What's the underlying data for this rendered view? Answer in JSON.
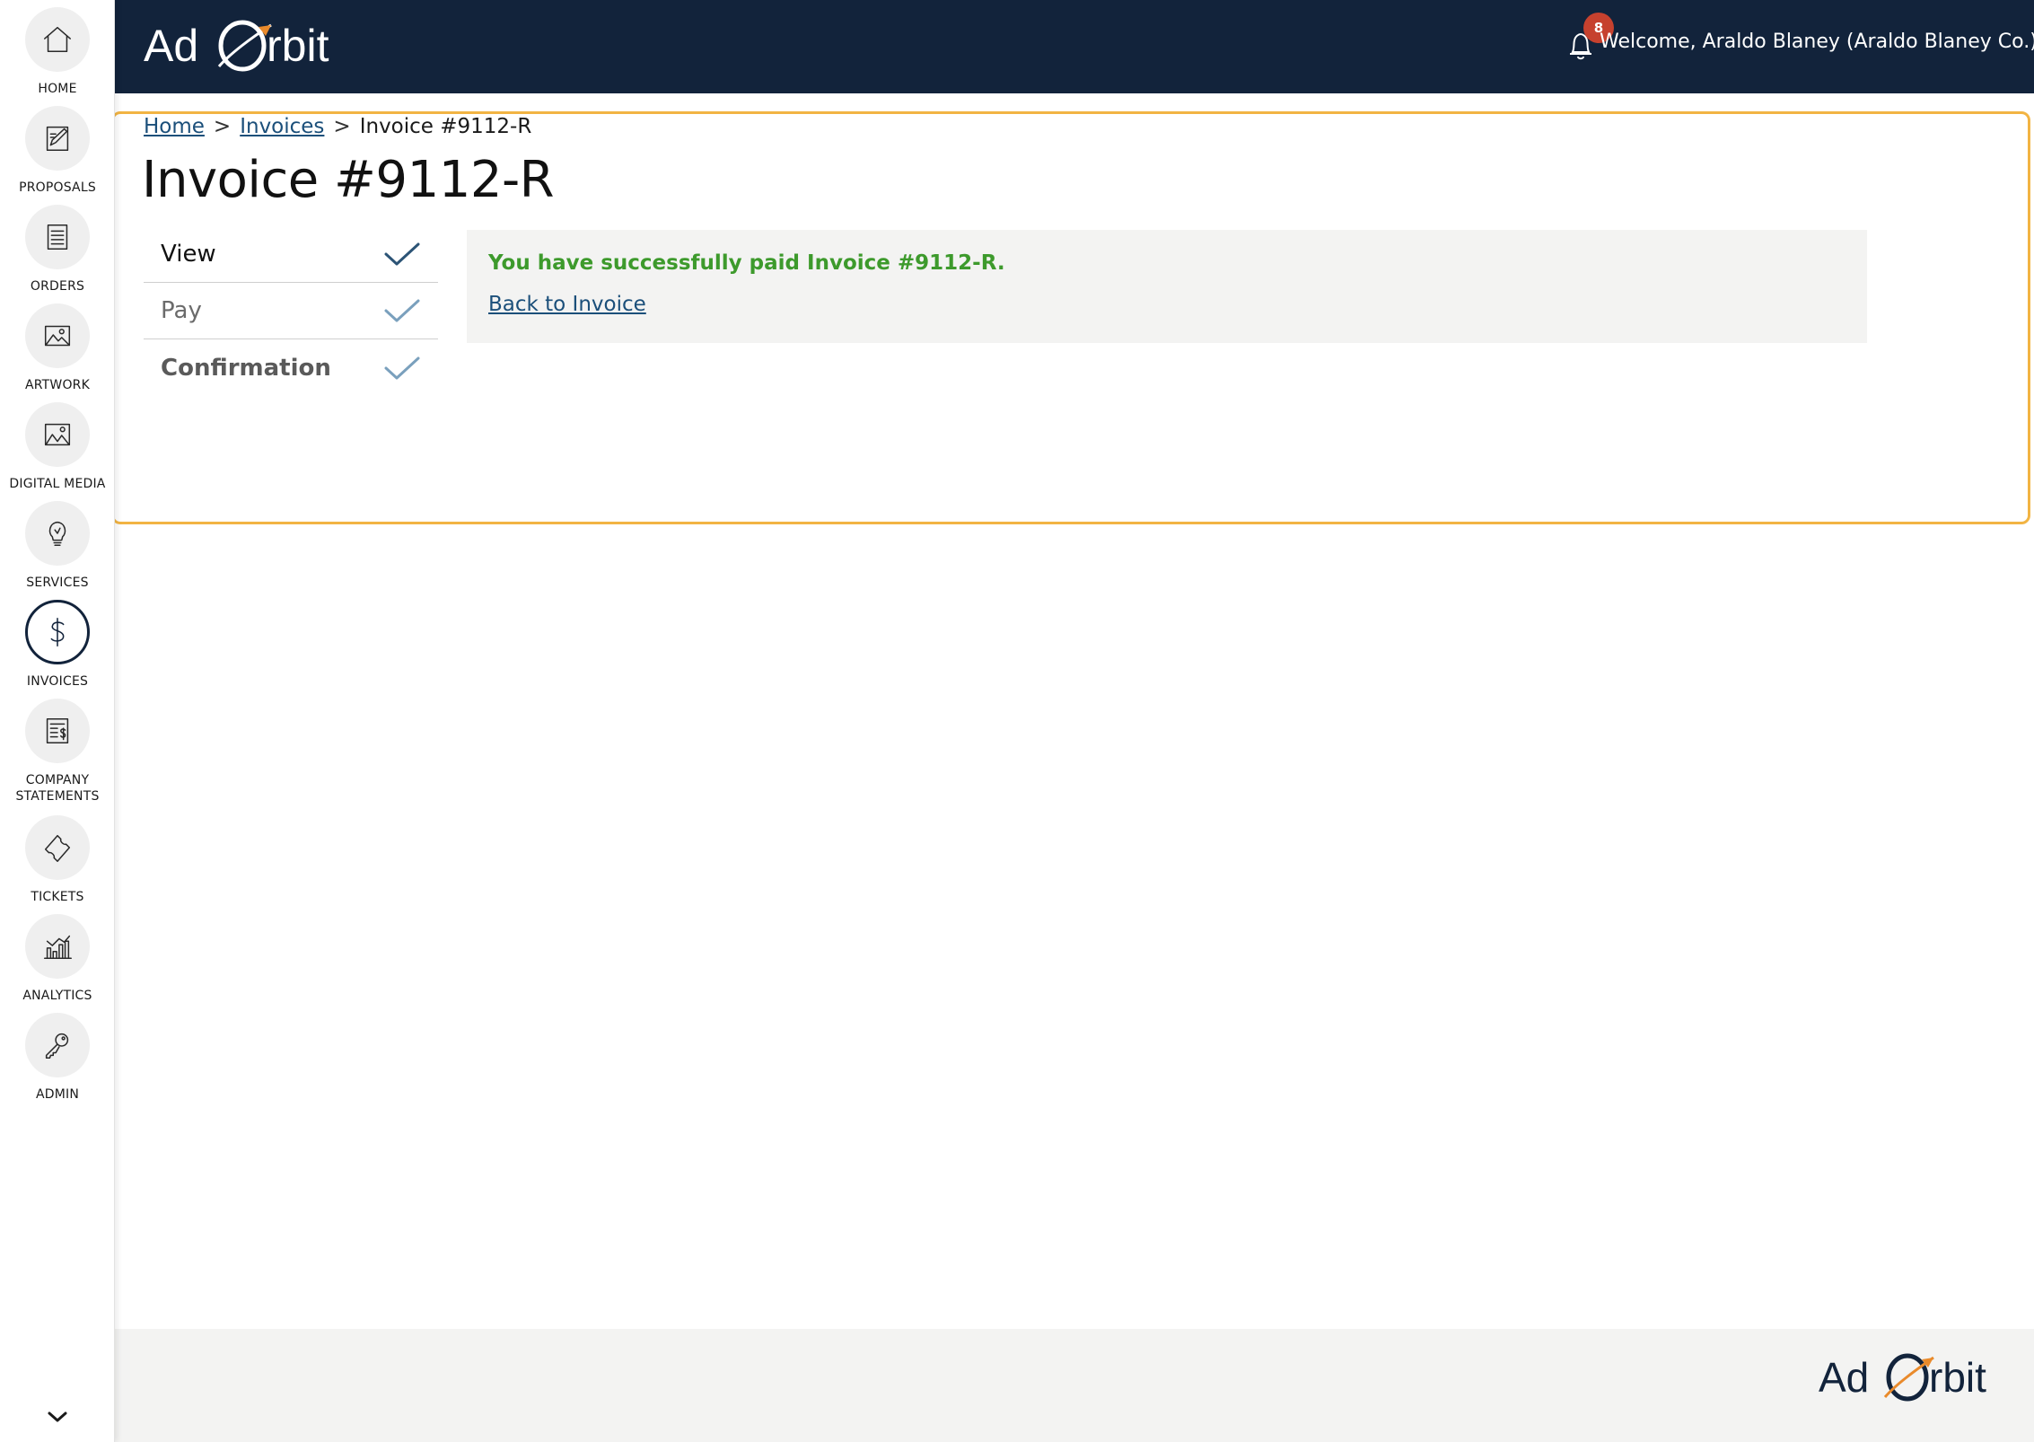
{
  "brand": {
    "logo_text_left": "Ad",
    "logo_text_right": "rbit",
    "footer_logo_text_left": "Ad",
    "footer_logo_text_right": "rbit",
    "primary_color": "#12233b",
    "accent_color": "#e98a2b"
  },
  "header": {
    "notification_count": "8",
    "welcome_text": "Welcome, Araldo Blaney (Araldo Blaney Co.)"
  },
  "sidebar": {
    "items": [
      {
        "label": "HOME",
        "icon": "home-icon"
      },
      {
        "label": "PROPOSALS",
        "icon": "proposal-icon"
      },
      {
        "label": "ORDERS",
        "icon": "orders-icon"
      },
      {
        "label": "ARTWORK",
        "icon": "artwork-icon"
      },
      {
        "label": "DIGITAL MEDIA",
        "icon": "digital-media-icon"
      },
      {
        "label": "SERVICES",
        "icon": "lightbulb-icon"
      },
      {
        "label": "INVOICES",
        "icon": "dollar-icon",
        "active": true
      },
      {
        "label": "COMPANY STATEMENTS",
        "icon": "statement-icon"
      },
      {
        "label": "TICKETS",
        "icon": "ticket-icon"
      },
      {
        "label": "ANALYTICS",
        "icon": "analytics-icon"
      },
      {
        "label": "ADMIN",
        "icon": "key-icon"
      }
    ]
  },
  "breadcrumb": {
    "home": "Home",
    "invoices": "Invoices",
    "separator": ">",
    "current": "Invoice #9112-R"
  },
  "page": {
    "title": "Invoice #9112-R"
  },
  "steps": [
    {
      "label": "View",
      "complete": true
    },
    {
      "label": "Pay",
      "complete": true
    },
    {
      "label": "Confirmation",
      "complete": true
    }
  ],
  "confirmation": {
    "message": "You have successfully paid Invoice #9112-R.",
    "status_color": "#3d9a2c",
    "back_link": "Back to Invoice"
  }
}
